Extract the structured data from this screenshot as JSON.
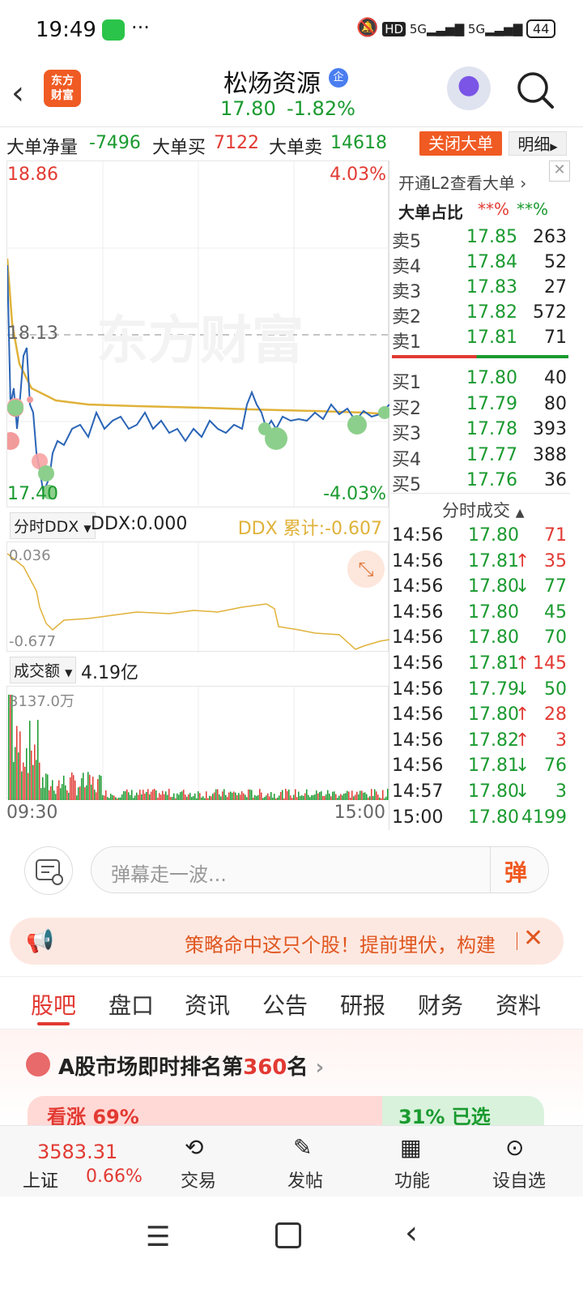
{
  "status_bar": {
    "time": "19:49",
    "hd": "HD",
    "net1": "5G",
    "net2": "5G",
    "battery": "44"
  },
  "header": {
    "logo": "东方\n财富",
    "name": "松炀资源",
    "tag": "企",
    "price": "17.80",
    "change": "-1.82%"
  },
  "big_order": {
    "net_label": "大单净量",
    "net_value": "-7496",
    "buy_label": "大单买",
    "buy_value": "7122",
    "sell_label": "大单卖",
    "sell_value": "14618",
    "close_btn": "关闭大单",
    "detail_btn": "明细"
  },
  "price_chart": {
    "top_price": "18.86",
    "top_pct": "4.03%",
    "mid_price": "18.13",
    "bottom_price": "17.40",
    "bottom_pct": "-4.03%",
    "watermark": "东方财富"
  },
  "ddx": {
    "selector": "分时DDX",
    "value_label": "DDX:0.000",
    "total_label": "DDX 累计:-0.607",
    "top": "0.036",
    "bottom": "-0.677"
  },
  "volume": {
    "selector": "成交额",
    "value": "4.19亿",
    "max": "3137.0万",
    "start_time": "09:30",
    "end_time": "15:00"
  },
  "order_book": {
    "l2_link": "开通L2查看大单",
    "ratio_label": "大单占比",
    "ratio_a": "**%",
    "ratio_b": "**%",
    "sells": [
      {
        "label": "卖5",
        "price": "17.85",
        "vol": "263"
      },
      {
        "label": "卖4",
        "price": "17.84",
        "vol": "52"
      },
      {
        "label": "卖3",
        "price": "17.83",
        "vol": "27"
      },
      {
        "label": "卖2",
        "price": "17.82",
        "vol": "572"
      },
      {
        "label": "卖1",
        "price": "17.81",
        "vol": "71"
      }
    ],
    "buys": [
      {
        "label": "买1",
        "price": "17.80",
        "vol": "40"
      },
      {
        "label": "买2",
        "price": "17.79",
        "vol": "80"
      },
      {
        "label": "买3",
        "price": "17.78",
        "vol": "393"
      },
      {
        "label": "买4",
        "price": "17.77",
        "vol": "388"
      },
      {
        "label": "买5",
        "price": "17.76",
        "vol": "36"
      }
    ],
    "trades_title": "分时成交",
    "trades": [
      {
        "time": "14:56",
        "price": "17.80",
        "arrow": "",
        "vol": "71",
        "color": "red"
      },
      {
        "time": "14:56",
        "price": "17.81",
        "arrow": "↑",
        "vol": "35",
        "color": "red"
      },
      {
        "time": "14:56",
        "price": "17.80",
        "arrow": "↓",
        "vol": "77",
        "color": "green"
      },
      {
        "time": "14:56",
        "price": "17.80",
        "arrow": "",
        "vol": "45",
        "color": "green"
      },
      {
        "time": "14:56",
        "price": "17.80",
        "arrow": "",
        "vol": "70",
        "color": "green"
      },
      {
        "time": "14:56",
        "price": "17.81",
        "arrow": "↑",
        "vol": "145",
        "color": "red"
      },
      {
        "time": "14:56",
        "price": "17.79",
        "arrow": "↓",
        "vol": "50",
        "color": "green"
      },
      {
        "time": "14:56",
        "price": "17.80",
        "arrow": "↑",
        "vol": "28",
        "color": "red"
      },
      {
        "time": "14:56",
        "price": "17.82",
        "arrow": "↑",
        "vol": "3",
        "color": "red"
      },
      {
        "time": "14:56",
        "price": "17.81",
        "arrow": "↓",
        "vol": "76",
        "color": "green"
      },
      {
        "time": "14:57",
        "price": "17.80",
        "arrow": "↓",
        "vol": "3",
        "color": "green"
      },
      {
        "time": "15:00",
        "price": "17.80",
        "arrow": "",
        "vol": "4199",
        "color": "green"
      }
    ]
  },
  "danmu": {
    "placeholder": "弹幕走一波...",
    "send": "弹"
  },
  "banner": {
    "text": "策略命中这只个股！提前埋伏，构建"
  },
  "tabs": [
    "股吧",
    "盘口",
    "资讯",
    "公告",
    "研报",
    "财务",
    "资料"
  ],
  "rank": {
    "prefix": "A股市场即时排名第",
    "num": "360",
    "suffix": "名",
    "bull": "看涨 69%",
    "bear": "31% 已选"
  },
  "bottom_nav": {
    "index_value": "3583.31",
    "index_name": "上证",
    "index_change": "0.66%",
    "trade": "交易",
    "post": "发帖",
    "func": "功能",
    "watch": "设自选"
  },
  "colors": {
    "red": "#e23a33",
    "green": "#1a9a2f",
    "accent": "#f05a23",
    "avg_line": "#e0b23a",
    "price_line": "#2a64b6"
  }
}
